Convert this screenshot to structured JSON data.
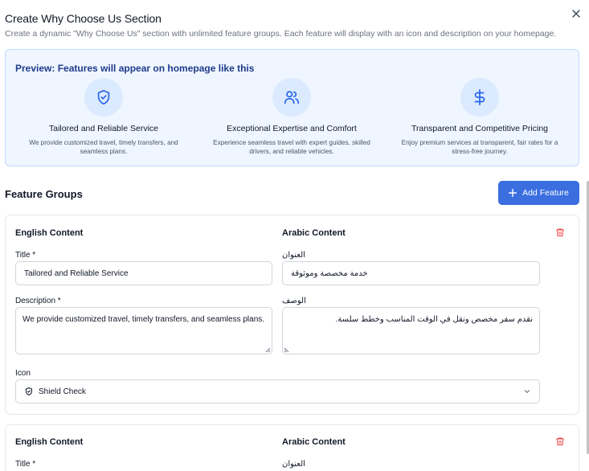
{
  "dialog": {
    "title": "Create Why Choose Us Section",
    "subtitle": "Create a dynamic \"Why Choose Us\" section with unlimited feature groups. Each feature will display with an icon and description on your homepage.",
    "close_icon": "close-icon"
  },
  "preview": {
    "title": "Preview: Features will appear on homepage like this",
    "cards": [
      {
        "icon": "shield-check-icon",
        "title": "Tailored and Reliable Service",
        "desc": "We provide customized travel, timely transfers, and seamless plans."
      },
      {
        "icon": "users-icon",
        "title": "Exceptional Expertise and Comfort",
        "desc": "Experience seamless travel with expert guides, skilled drivers, and reliable vehicles."
      },
      {
        "icon": "dollar-sign-icon",
        "title": "Transparent and Competitive Pricing",
        "desc": "Enjoy premium services at transparent, fair rates for a stress-free journey."
      }
    ]
  },
  "groups": {
    "title": "Feature Groups",
    "add_label": "Add Feature"
  },
  "feature1": {
    "english_heading": "English Content",
    "arabic_heading": "Arabic Content",
    "title_label": "Title *",
    "title_value": "Tailored and Reliable Service",
    "ar_title_label": "العنوان",
    "ar_title_value": "خدمة مخصصة وموثوقة",
    "desc_label": "Description *",
    "desc_value": "We provide customized travel, timely transfers, and seamless plans.",
    "ar_desc_label": "الوصف",
    "ar_desc_value": "نقدم سفر مخصص ونقل في الوقت المناسب وخطط سلسة.",
    "icon_label": "Icon",
    "icon_value": "Shield Check"
  },
  "feature2": {
    "english_heading": "English Content",
    "arabic_heading": "Arabic Content",
    "title_label": "Title *",
    "ar_title_label": "العنوان"
  },
  "colors": {
    "accent": "#3b6fe0",
    "preview_bg": "#eff6ff",
    "icon_blue": "#2563eb",
    "danger": "#ef4444"
  }
}
